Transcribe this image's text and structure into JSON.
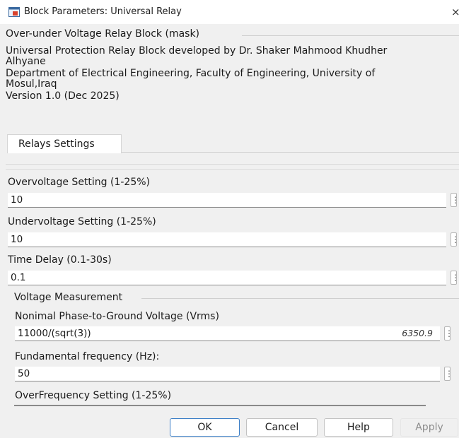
{
  "window": {
    "title": "Block Parameters: Universal Relay",
    "close_glyph": "×",
    "icon": "simulink-block-icon"
  },
  "mask": {
    "heading": "Over-under Voltage Relay Block (mask)",
    "description": [
      "Universal Protection  Relay Block developed by Dr. Shaker Mahmood Khudher",
      "Alhyane",
      "Department of Electrical Engineering, Faculty of Engineering, University of",
      "Mosul,Iraq",
      "Version 1.0 (Dec 2025)"
    ]
  },
  "tabs": [
    {
      "label": "Relays Settings"
    }
  ],
  "params": {
    "overvoltage": {
      "label": "Overvoltage Setting (1-25%)",
      "value": "10"
    },
    "undervoltage": {
      "label": "Undervoltage Setting (1-25%)",
      "value": "10"
    },
    "time_delay": {
      "label": "Time Delay (0.1-30s)",
      "value": "0.1"
    }
  },
  "voltage_measurement": {
    "group_label": "Voltage Measurement",
    "nominal_voltage": {
      "label": "Nonimal Phase-to-Ground Voltage (Vrms)",
      "value": "11000/(sqrt(3))",
      "evaluated": "6350.9"
    },
    "frequency": {
      "label": "Fundamental frequency (Hz):",
      "value": "50"
    },
    "overfrequency": {
      "label": "OverFrequency Setting (1-25%)"
    }
  },
  "menu_glyph": "⋮",
  "buttons": {
    "ok": "OK",
    "cancel": "Cancel",
    "help": "Help",
    "apply": "Apply"
  },
  "colors": {
    "primary_border": "#3c7fc7",
    "field_bg": "#ffffff",
    "dialog_bg": "#f0f0f0"
  }
}
